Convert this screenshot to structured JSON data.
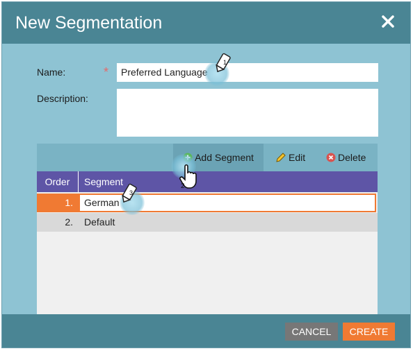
{
  "dialog": {
    "title": "New Segmentation",
    "close_icon": "close-icon"
  },
  "form": {
    "name_label": "Name:",
    "required_mark": "*",
    "name_value": "Preferred Language",
    "description_label": "Description:",
    "description_value": ""
  },
  "toolbar": {
    "add_label": "Add Segment",
    "edit_label": "Edit",
    "delete_label": "Delete"
  },
  "table": {
    "headers": [
      "Order",
      "Segment"
    ],
    "rows": [
      {
        "order": "1.",
        "segment": "German"
      },
      {
        "order": "2.",
        "segment": "Default"
      }
    ]
  },
  "footer": {
    "cancel_label": "CANCEL",
    "create_label": "CREATE"
  },
  "annotations": {
    "step1": "1",
    "step2": "2",
    "step3": "3"
  },
  "colors": {
    "header": "#4a8594",
    "body": "#8ec3d3",
    "accent": "#f07a33",
    "table_header": "#5e55a6"
  }
}
